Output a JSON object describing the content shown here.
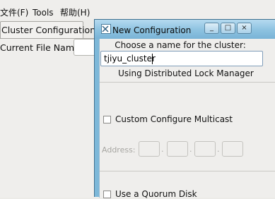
{
  "window": {
    "menus": [
      "文件(F)",
      "Tools",
      "帮助(H)"
    ],
    "tab": "Cluster Configuration",
    "current_file_label": "Current File Name:",
    "current_file_value": ""
  },
  "dialog": {
    "title": "New Configuration",
    "window_buttons": {
      "minimize": "_",
      "maximize": "□",
      "close": "×"
    },
    "prompt": "Choose a name for the cluster:",
    "cluster_name": "tjiyu_cluster",
    "lock_manager_text": "Using Distributed Lock Manager",
    "multicast": {
      "label": "Custom Configure Multicast",
      "checked": false
    },
    "address": {
      "label": "Address:",
      "octets": [
        "",
        "",
        "",
        ""
      ],
      "enabled": false
    },
    "quorum": {
      "label": "Use a Quorum Disk",
      "checked": false
    }
  },
  "colors": {
    "title_bar": "#8cc2e0",
    "window_bg": "#efeeec",
    "disabled_text": "#a7a6a2"
  }
}
